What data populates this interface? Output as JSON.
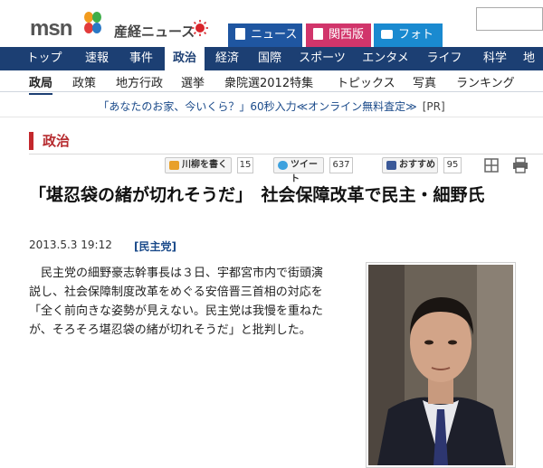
{
  "header": {
    "msn_logo": "msn",
    "site_logo": "産経ニュース",
    "tabs": [
      {
        "label": "ニュース",
        "icon": "document-icon"
      },
      {
        "label": "関西版",
        "icon": "bookmark-icon"
      },
      {
        "label": "フォト",
        "icon": "camera-icon"
      }
    ]
  },
  "mainnav": [
    "トップ",
    "速報",
    "事件",
    "政治",
    "経済",
    "国際",
    "スポーツ",
    "エンタメ",
    "ライフ",
    "科学",
    "地方"
  ],
  "mainnav_active": "政治",
  "subnav": [
    "政局",
    "政策",
    "地方行政",
    "選挙",
    "衆院選2012特集",
    "トピックス",
    "写真",
    "ランキング"
  ],
  "subnav_active": "政局",
  "ad": {
    "text": "「あなたのお家、今いくら？」60秒入力≪オンライン無料査定≫",
    "pr": "[PR]"
  },
  "section": {
    "title": "政治"
  },
  "social": {
    "senryu": {
      "label": "川柳を書く",
      "count": "15"
    },
    "tweet": {
      "label": "ツイート",
      "count": "637"
    },
    "recommend": {
      "label": "おすすめ",
      "count": "95"
    }
  },
  "article": {
    "headline": "「堪忍袋の緒が切れそうだ」　社会保障改革で民主・細野氏",
    "date": "2013.5.3 19:12",
    "tag": "[民主党]",
    "body": "民主党の細野豪志幹事長は３日、宇都宮市内で街頭演説し、社会保障制度改革をめぐる安倍晋三首相の対応を「全く前向きな姿勢が見えない。民主党は我慢を重ねたが、そろそろ堪忍袋の緒が切れそうだ」と批判した。"
  },
  "colors": {
    "nav_bg": "#1c3f73",
    "news_tab": "#1f56a1",
    "kansai_tab": "#d1356b",
    "photo_tab": "#1a8ad0",
    "section_accent": "#c3282d"
  }
}
